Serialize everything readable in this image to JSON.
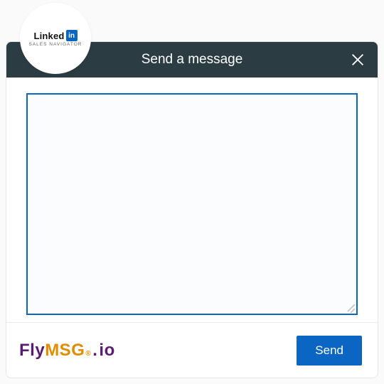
{
  "badge": {
    "linked": "Linked",
    "in": "in",
    "sub": "SALES NAVIGATOR"
  },
  "header": {
    "title": "Send a message"
  },
  "compose": {
    "value": "",
    "placeholder": ""
  },
  "footer": {
    "brand": {
      "fly": "Fly",
      "msg": "MSG",
      "reg": "®",
      "dot": ".",
      "io": "io"
    },
    "send_label": "Send"
  }
}
